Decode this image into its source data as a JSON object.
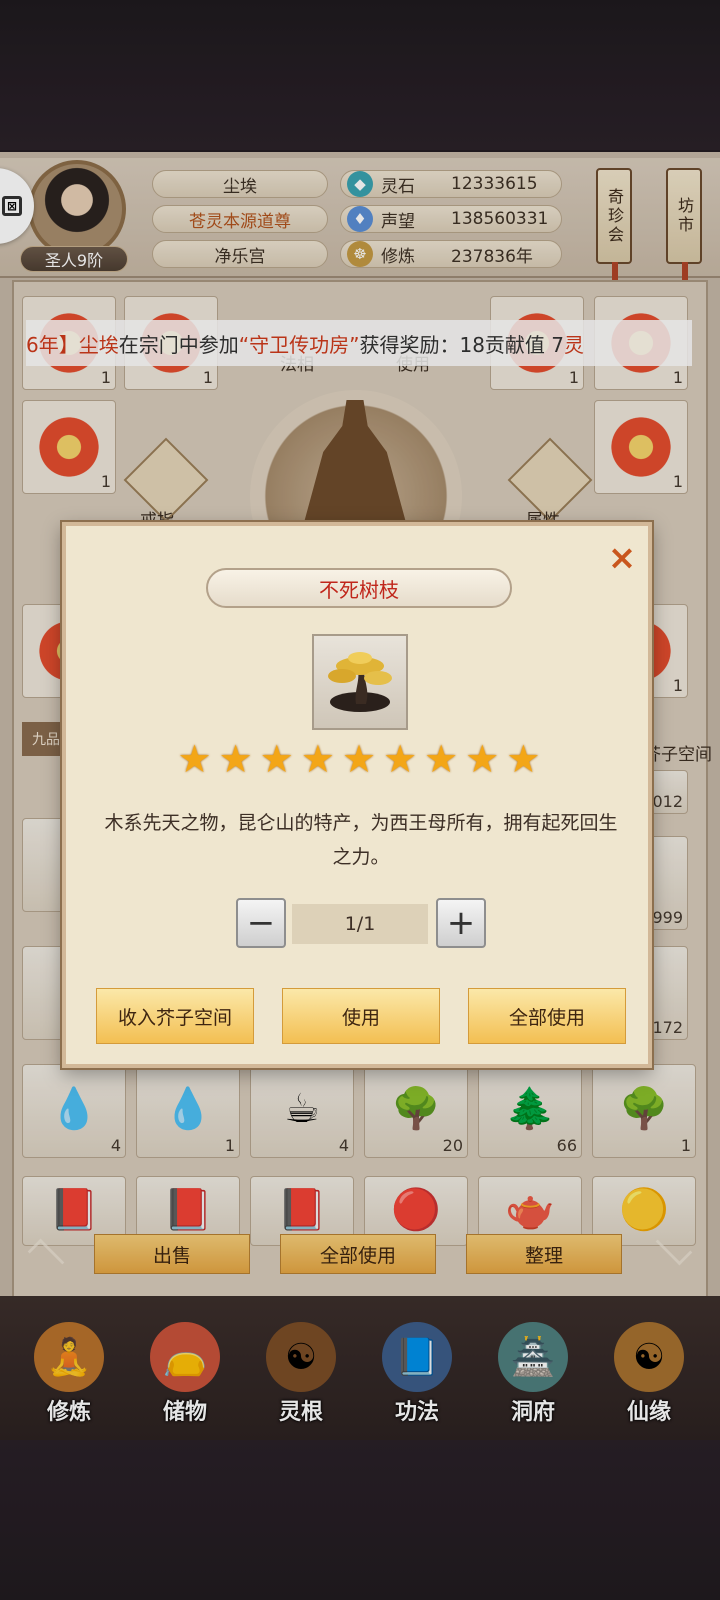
{
  "header": {
    "player_name": "尘埃",
    "player_title": "苍灵本源道尊",
    "sect": "净乐宫",
    "rank": "圣人9阶",
    "resources": [
      {
        "label": "灵石",
        "value": "12333615",
        "icon": "spirit-stone-icon",
        "color": "#3aa3b0"
      },
      {
        "label": "声望",
        "value": "138560331",
        "icon": "prestige-crystal-icon",
        "color": "#5b8fd6"
      },
      {
        "label": "修炼",
        "value": "237836年",
        "icon": "meditation-icon",
        "color": "#c49a43"
      }
    ],
    "side_buttons": [
      "奇珍会",
      "坊市"
    ]
  },
  "ticker": {
    "prefix": "6年】",
    "player": "尘埃",
    "text1": "在宗门中参加",
    "event": "“守卫传功房”",
    "text2": "获得奖励：18贡献值 7",
    "suffix": "灵"
  },
  "equip_labels": {
    "top_left": "法相",
    "top_right": "使用",
    "left": "戒指",
    "right": "属性"
  },
  "bag": {
    "tab_grade": "九品",
    "tab_space": "芥子空间",
    "partial_counts": [
      "7012",
      "999",
      "172"
    ],
    "row_counts": [
      [
        "4",
        "1",
        "4",
        "20",
        "66",
        "1"
      ]
    ],
    "top_counts": [
      "1",
      "1",
      "1",
      "1",
      "1",
      "1",
      "1"
    ]
  },
  "actions": [
    "出售",
    "全部使用",
    "整理"
  ],
  "nav": [
    {
      "label": "修炼",
      "icon": "cultivate-icon"
    },
    {
      "label": "储物",
      "icon": "storage-bag-icon"
    },
    {
      "label": "灵根",
      "icon": "spirit-root-icon"
    },
    {
      "label": "功法",
      "icon": "technique-book-icon"
    },
    {
      "label": "洞府",
      "icon": "cave-dwelling-icon"
    },
    {
      "label": "仙缘",
      "icon": "immortal-fate-icon"
    }
  ],
  "dialog": {
    "title": "不死树枝",
    "stars": 9,
    "description": "木系先天之物，昆仑山的特产，为西王母所有，拥有起死回生之力。",
    "quantity": "1/1",
    "buttons": [
      "收入芥子空间",
      "使用",
      "全部使用"
    ],
    "close": "×",
    "minus": "−",
    "plus": "+"
  }
}
